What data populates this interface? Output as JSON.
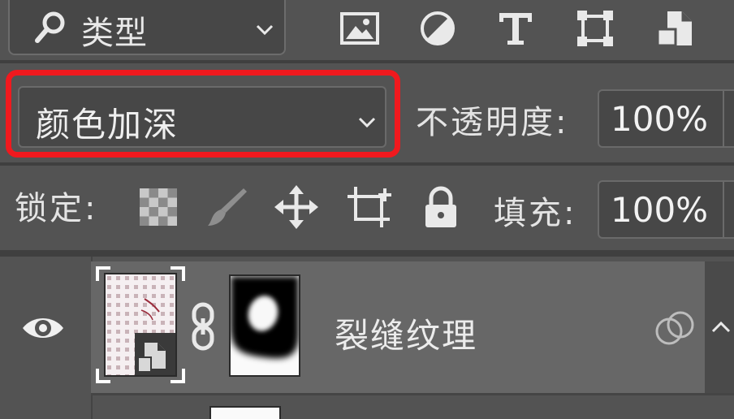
{
  "filter": {
    "label": "类型",
    "icons": [
      "search-icon",
      "chevron-down-icon"
    ]
  },
  "kind_filters": [
    "image-filter-icon",
    "adjustment-filter-icon",
    "type-filter-icon",
    "shape-filter-icon",
    "smart-object-filter-icon"
  ],
  "blend_mode": {
    "value": "颜色加深",
    "icon": "chevron-down-icon"
  },
  "opacity": {
    "label": "不透明度:",
    "value": "100%"
  },
  "lock": {
    "label": "锁定:",
    "icons": [
      "lock-transparent-pixels-icon",
      "lock-image-pixels-icon",
      "lock-position-icon",
      "lock-artboard-icon",
      "lock-all-icon"
    ]
  },
  "fill": {
    "label": "填充:",
    "value": "100%"
  },
  "layer": {
    "name": "裂缝纹理",
    "icons": [
      "eye-icon",
      "smart-object-badge-icon",
      "link-icon",
      "blend-interior-icon",
      "chevron-up-icon"
    ]
  },
  "colors": {
    "panel": "#535353",
    "field": "#474747",
    "layer_selected": "#676767",
    "highlight": "#f0191e"
  }
}
